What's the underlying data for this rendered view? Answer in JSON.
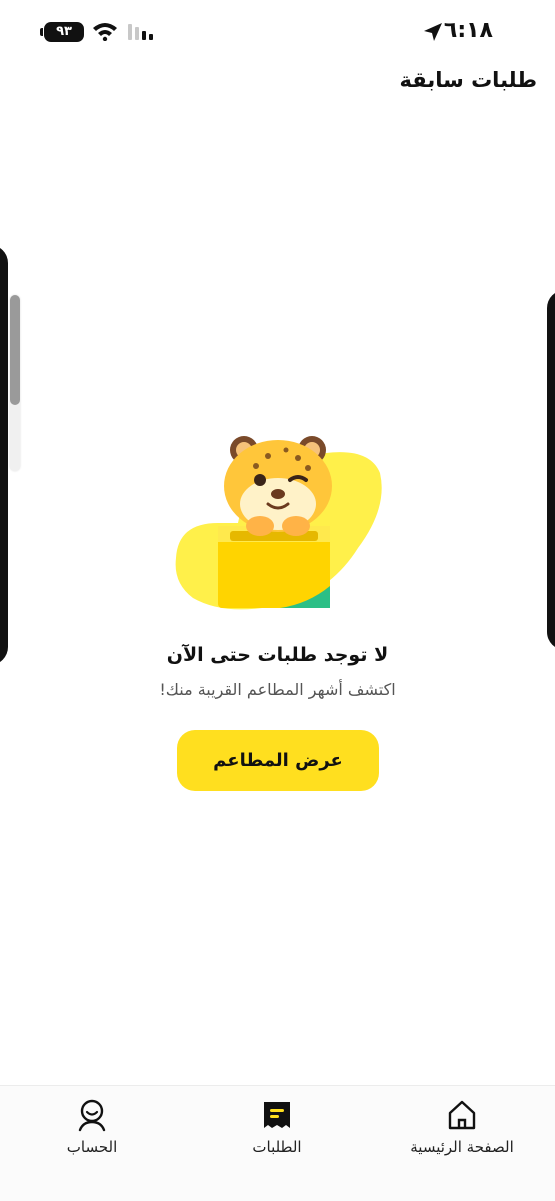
{
  "status_bar": {
    "time": "٦:١٨",
    "battery": "٩٣",
    "icons": [
      "location-arrow-icon",
      "wifi-icon",
      "cellular-signal-icon",
      "battery-icon"
    ]
  },
  "header": {
    "title": "طلبات سابقة"
  },
  "empty_state": {
    "title": "لا توجد طلبات حتى الآن",
    "subtitle": "اكتشف أشهر المطاعم القريبة منك!",
    "button_label": "عرض المطاعم",
    "illustration": "cheetah-in-box-illustration"
  },
  "bottom_nav": {
    "items": [
      {
        "label": "الصفحة الرئيسية",
        "icon": "home-icon"
      },
      {
        "label": "الطلبات",
        "icon": "orders-receipt-icon",
        "active": true
      },
      {
        "label": "الحساب",
        "icon": "account-icon"
      }
    ]
  },
  "colors": {
    "accent": "#FFDF1F",
    "background": "#FFFFFF",
    "text": "#111111"
  }
}
